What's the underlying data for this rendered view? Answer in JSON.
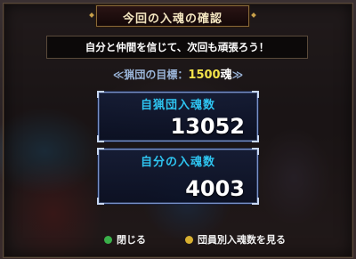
{
  "dialog": {
    "title": "今回の入魂の確認",
    "message": "自分と仲間を信じて、次回も頑張ろう！"
  },
  "goal": {
    "label": "≪猟団の目標：",
    "value": "1500",
    "unit": "魂",
    "close": "≫"
  },
  "clan_panel": {
    "label": "自猟団入魂数",
    "value": "13052"
  },
  "self_panel": {
    "label": "自分の入魂数",
    "value": "4003"
  },
  "buttons": {
    "close": "閉じる",
    "members": "団員別入魂数を見る"
  }
}
